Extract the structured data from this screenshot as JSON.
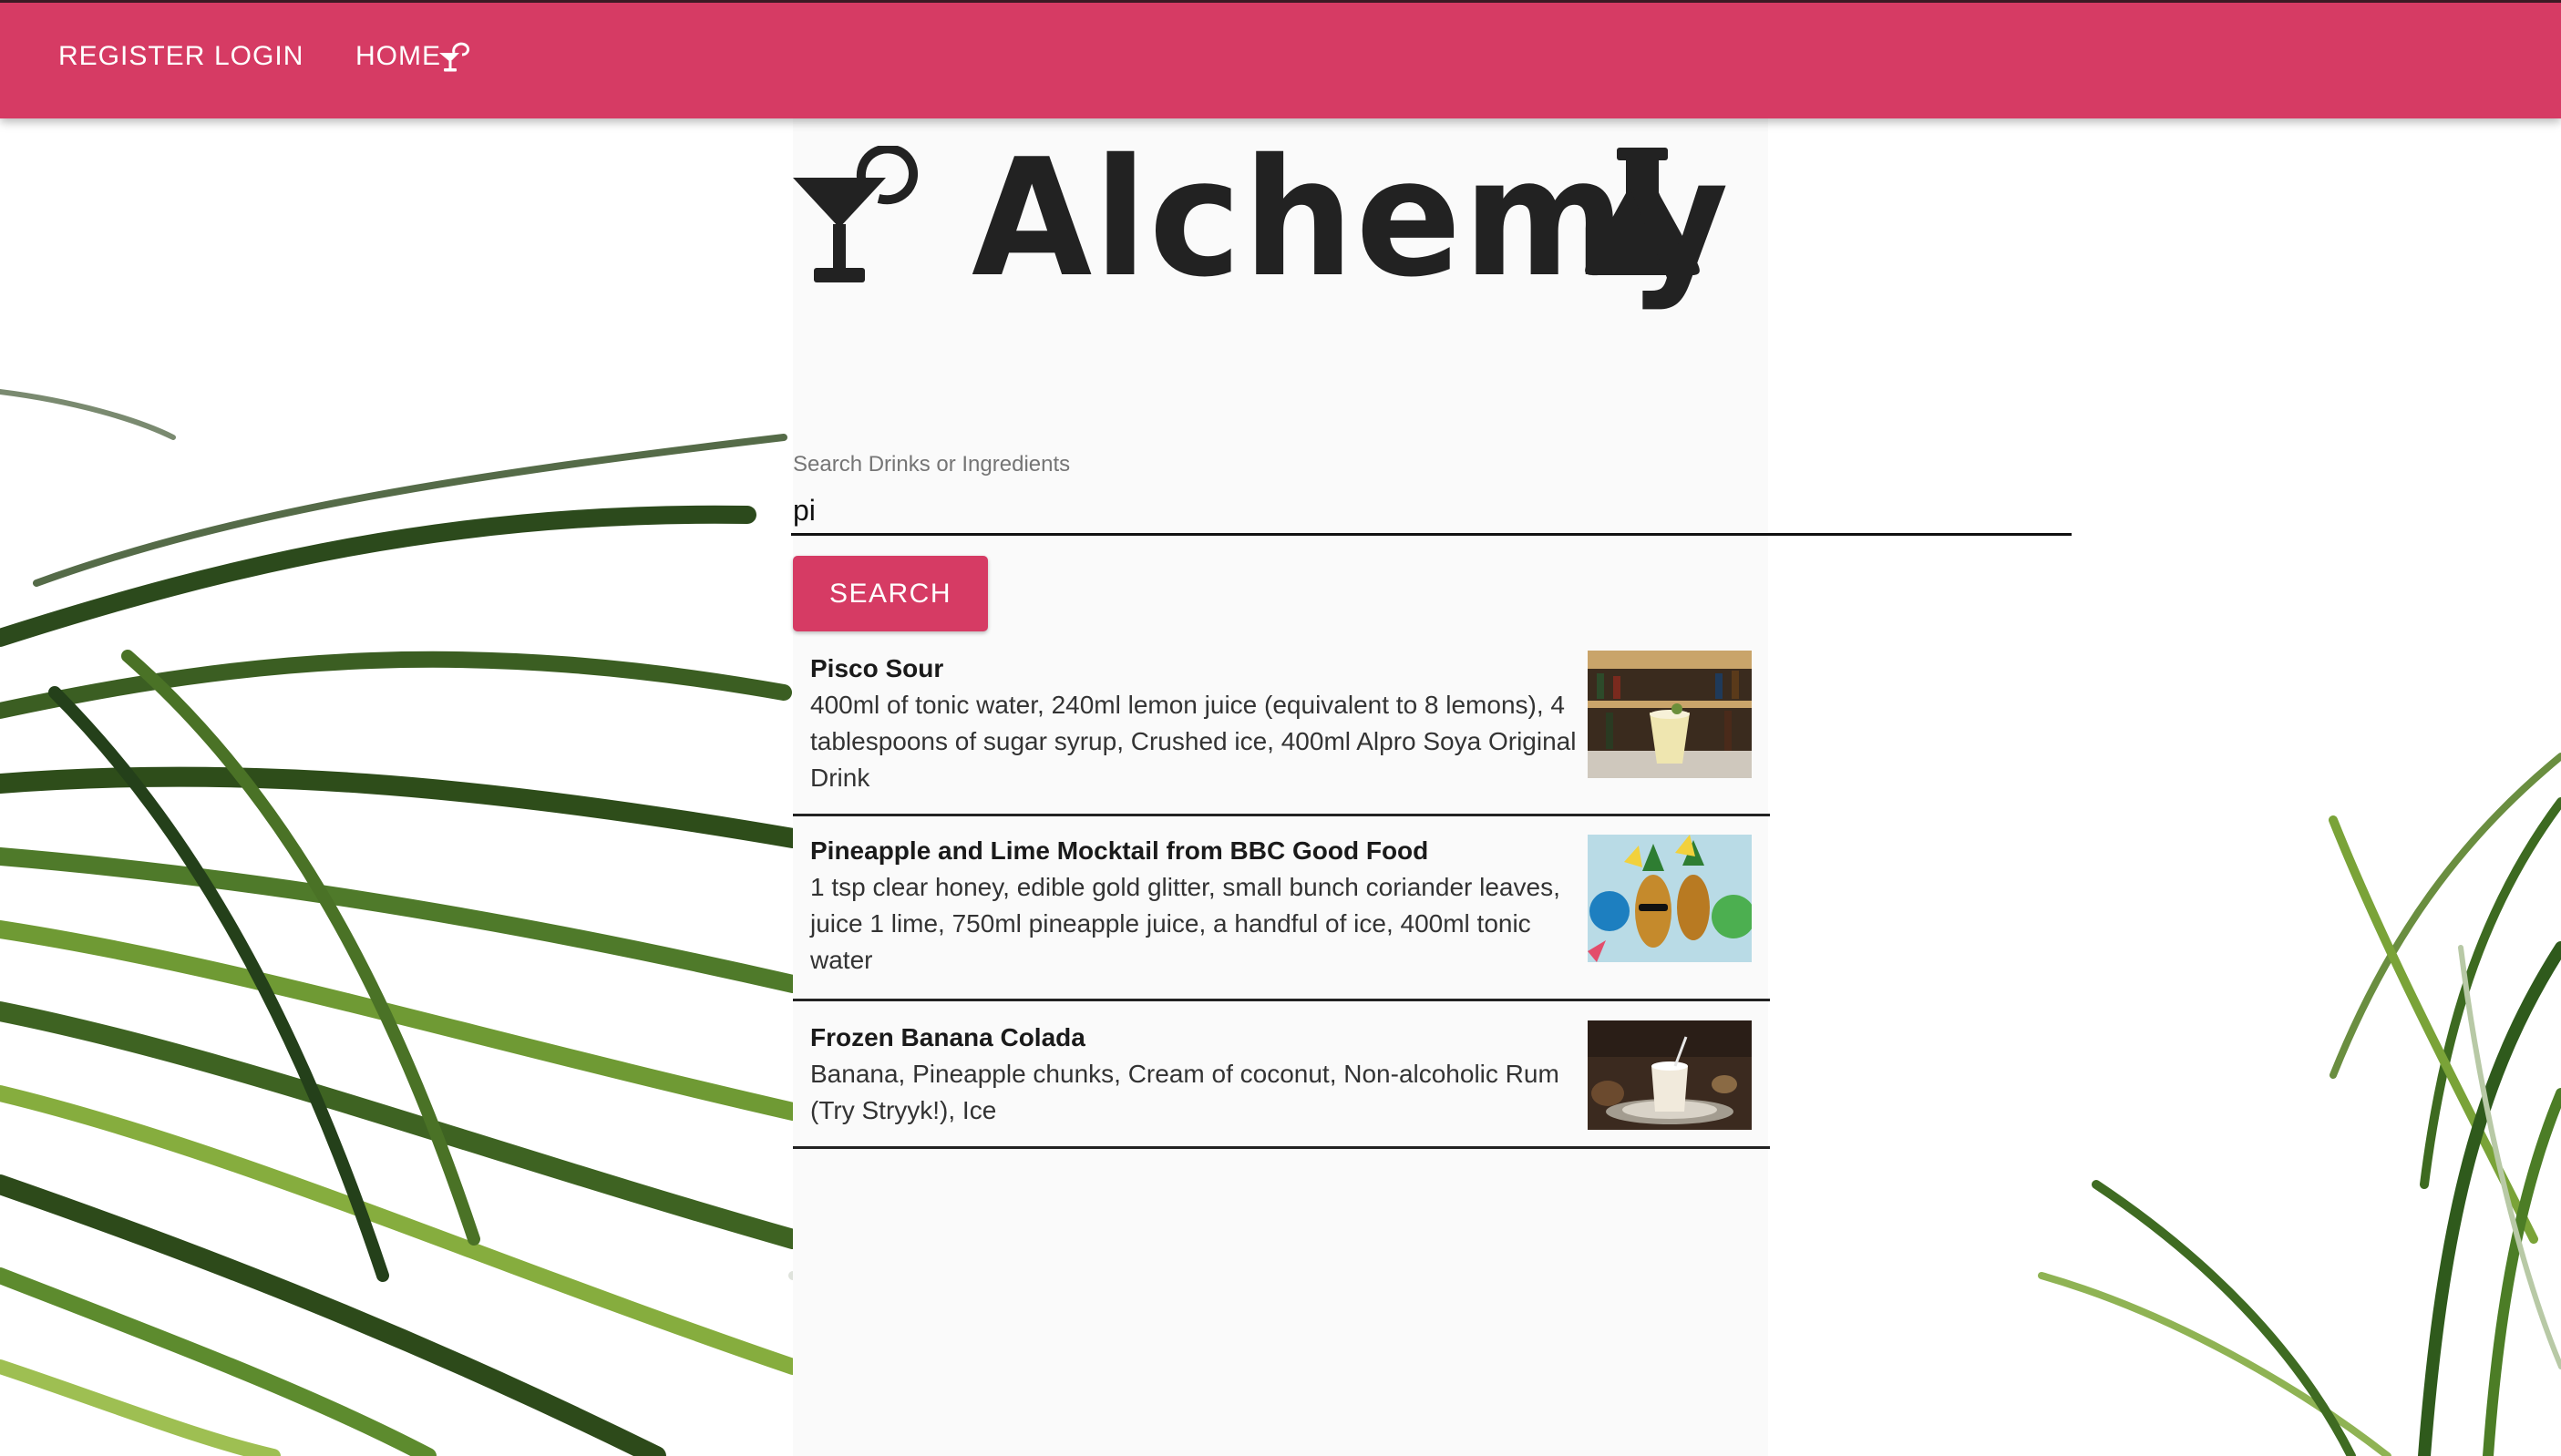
{
  "nav": {
    "register_label": "REGISTER",
    "login_label": "LOGIN",
    "home_label": "HOME",
    "home_icon": "cocktail-icon"
  },
  "logo": {
    "text": "Alchemy",
    "left_icon": "cocktail-glass-icon",
    "right_icon": "flask-icon"
  },
  "search": {
    "label": "Search Drinks or Ingredients",
    "value": "pi",
    "button_label": "SEARCH"
  },
  "results": [
    {
      "title": "Pisco Sour",
      "ingredients": "400ml of tonic water, 240ml lemon juice (equivalent to 8 lemons), 4 tablespoons of sugar syrup, Crushed ice, 400ml Alpro Soya Original Drink"
    },
    {
      "title": "Pineapple and Lime Mocktail from BBC Good Food",
      "ingredients": "1 tsp clear honey, edible gold glitter, small bunch coriander leaves, juice 1 lime, 750ml pineapple juice, a handful of ice, 400ml tonic water"
    },
    {
      "title": "Frozen Banana Colada",
      "ingredients": "Banana, Pineapple chunks, Cream of coconut, Non-alcoholic Rum (Try Stryyk!), Ice"
    }
  ],
  "colors": {
    "brand": "#d63b64",
    "text_dark": "#222222",
    "label_gray": "#757575"
  }
}
